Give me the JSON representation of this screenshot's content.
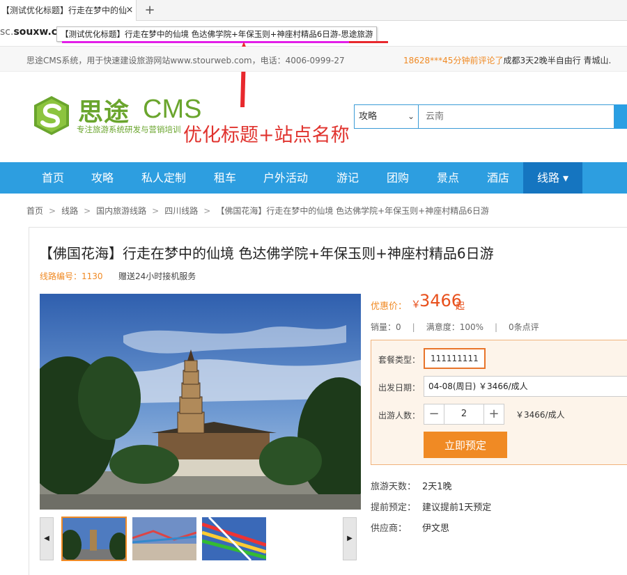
{
  "browser": {
    "tab_title": "【测试优化标题】行走在梦中的仙",
    "close_glyph": "×",
    "new_tab_glyph": "+",
    "url_prefix": "sc.",
    "url_domain": "souxw.co",
    "tooltip": "【测试优化标题】行走在梦中的仙境 色达佛学院+年保玉则+神座村精品6日游-思途旅游"
  },
  "topbar": {
    "intro": "思途CMS系统，用于快速建设旅游网站www.stourweb.com，电话：4006-0999-27",
    "review_user": "18628***45分钟前评论了",
    "review_item": "成都3天2晚半自由行 青城山."
  },
  "header": {
    "logo_cn": "思途",
    "logo_en": "CMS",
    "logo_sub": "专注旅游系统研发与营销培训",
    "annotation": "优化标题+站点名称",
    "search_type": "攻略",
    "search_placeholder": "云南"
  },
  "nav": {
    "items": [
      "首页",
      "攻略",
      "私人定制",
      "租车",
      "户外活动",
      "游记",
      "团购",
      "景点",
      "酒店",
      "线路 ▾"
    ]
  },
  "breadcrumb": [
    "首页",
    "线路",
    "国内旅游线路",
    "四川线路",
    "【佛国花海】行走在梦中的仙境 色达佛学院+年保玉则+神座村精品6日游"
  ],
  "product": {
    "title": "【佛国花海】行走在梦中的仙境 色达佛学院+年保玉则+神座村精品6日游",
    "line_no": "线路编号：1130",
    "gift": "赠送24小时接机服务",
    "price_label": "优惠价：",
    "currency": "￥",
    "price": "3466",
    "price_suffix": "起",
    "sales": "销量：0",
    "satisfaction": "满意度：100%",
    "reviews": "0条点评",
    "package_label": "套餐类型：",
    "package_value": "111111111",
    "date_label": "出发日期：",
    "date_value": "04-08(周日) ￥3466/成人",
    "people_label": "出游人数：",
    "minus": "−",
    "qty": "2",
    "plus": "+",
    "unit_price": "￥3466/成人",
    "book_label": "立即预定",
    "days_label": "旅游天数：",
    "days_value": "2天1晚",
    "advance_label": "提前预定：",
    "advance_value": "建议提前1天预定",
    "supplier_label": "供应商：",
    "supplier_value": "伊文思",
    "prev_glyph": "◀",
    "next_glyph": "▶"
  },
  "colors": {
    "nav_bg": "#2d9ee0",
    "nav_active": "#1575c0",
    "accent_orange": "#f08a24",
    "price_red": "#e8501c",
    "logo_green": "#6aa52d"
  }
}
